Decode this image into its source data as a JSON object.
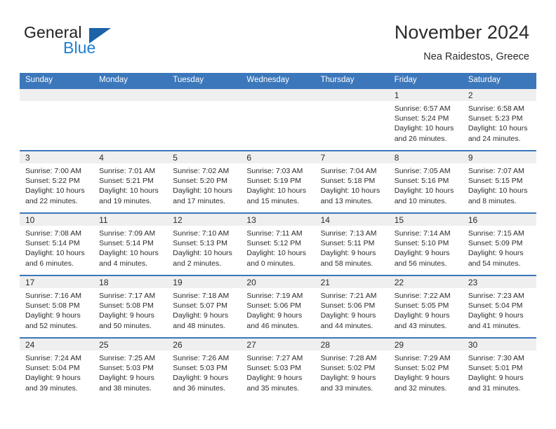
{
  "logo": {
    "text_primary": "General",
    "text_secondary": "Blue",
    "triangle_icon": "triangle-icon",
    "primary_color": "#231f20",
    "secondary_color": "#1e7fd4",
    "triangle_color": "#1b62a8"
  },
  "header": {
    "title": "November 2024",
    "subtitle": "Nea Raidestos, Greece"
  },
  "theme": {
    "header_bar_color": "#3b77ba",
    "day_band_color": "#efefef",
    "text_color": "#2b2b2b"
  },
  "weekdays": [
    "Sunday",
    "Monday",
    "Tuesday",
    "Wednesday",
    "Thursday",
    "Friday",
    "Saturday"
  ],
  "weeks": [
    [
      {
        "day": "",
        "sunrise": "",
        "sunset": "",
        "daylight_line1": "",
        "daylight_line2": ""
      },
      {
        "day": "",
        "sunrise": "",
        "sunset": "",
        "daylight_line1": "",
        "daylight_line2": ""
      },
      {
        "day": "",
        "sunrise": "",
        "sunset": "",
        "daylight_line1": "",
        "daylight_line2": ""
      },
      {
        "day": "",
        "sunrise": "",
        "sunset": "",
        "daylight_line1": "",
        "daylight_line2": ""
      },
      {
        "day": "",
        "sunrise": "",
        "sunset": "",
        "daylight_line1": "",
        "daylight_line2": ""
      },
      {
        "day": "1",
        "sunrise": "Sunrise: 6:57 AM",
        "sunset": "Sunset: 5:24 PM",
        "daylight_line1": "Daylight: 10 hours",
        "daylight_line2": "and 26 minutes."
      },
      {
        "day": "2",
        "sunrise": "Sunrise: 6:58 AM",
        "sunset": "Sunset: 5:23 PM",
        "daylight_line1": "Daylight: 10 hours",
        "daylight_line2": "and 24 minutes."
      }
    ],
    [
      {
        "day": "3",
        "sunrise": "Sunrise: 7:00 AM",
        "sunset": "Sunset: 5:22 PM",
        "daylight_line1": "Daylight: 10 hours",
        "daylight_line2": "and 22 minutes."
      },
      {
        "day": "4",
        "sunrise": "Sunrise: 7:01 AM",
        "sunset": "Sunset: 5:21 PM",
        "daylight_line1": "Daylight: 10 hours",
        "daylight_line2": "and 19 minutes."
      },
      {
        "day": "5",
        "sunrise": "Sunrise: 7:02 AM",
        "sunset": "Sunset: 5:20 PM",
        "daylight_line1": "Daylight: 10 hours",
        "daylight_line2": "and 17 minutes."
      },
      {
        "day": "6",
        "sunrise": "Sunrise: 7:03 AM",
        "sunset": "Sunset: 5:19 PM",
        "daylight_line1": "Daylight: 10 hours",
        "daylight_line2": "and 15 minutes."
      },
      {
        "day": "7",
        "sunrise": "Sunrise: 7:04 AM",
        "sunset": "Sunset: 5:18 PM",
        "daylight_line1": "Daylight: 10 hours",
        "daylight_line2": "and 13 minutes."
      },
      {
        "day": "8",
        "sunrise": "Sunrise: 7:05 AM",
        "sunset": "Sunset: 5:16 PM",
        "daylight_line1": "Daylight: 10 hours",
        "daylight_line2": "and 10 minutes."
      },
      {
        "day": "9",
        "sunrise": "Sunrise: 7:07 AM",
        "sunset": "Sunset: 5:15 PM",
        "daylight_line1": "Daylight: 10 hours",
        "daylight_line2": "and 8 minutes."
      }
    ],
    [
      {
        "day": "10",
        "sunrise": "Sunrise: 7:08 AM",
        "sunset": "Sunset: 5:14 PM",
        "daylight_line1": "Daylight: 10 hours",
        "daylight_line2": "and 6 minutes."
      },
      {
        "day": "11",
        "sunrise": "Sunrise: 7:09 AM",
        "sunset": "Sunset: 5:14 PM",
        "daylight_line1": "Daylight: 10 hours",
        "daylight_line2": "and 4 minutes."
      },
      {
        "day": "12",
        "sunrise": "Sunrise: 7:10 AM",
        "sunset": "Sunset: 5:13 PM",
        "daylight_line1": "Daylight: 10 hours",
        "daylight_line2": "and 2 minutes."
      },
      {
        "day": "13",
        "sunrise": "Sunrise: 7:11 AM",
        "sunset": "Sunset: 5:12 PM",
        "daylight_line1": "Daylight: 10 hours",
        "daylight_line2": "and 0 minutes."
      },
      {
        "day": "14",
        "sunrise": "Sunrise: 7:13 AM",
        "sunset": "Sunset: 5:11 PM",
        "daylight_line1": "Daylight: 9 hours",
        "daylight_line2": "and 58 minutes."
      },
      {
        "day": "15",
        "sunrise": "Sunrise: 7:14 AM",
        "sunset": "Sunset: 5:10 PM",
        "daylight_line1": "Daylight: 9 hours",
        "daylight_line2": "and 56 minutes."
      },
      {
        "day": "16",
        "sunrise": "Sunrise: 7:15 AM",
        "sunset": "Sunset: 5:09 PM",
        "daylight_line1": "Daylight: 9 hours",
        "daylight_line2": "and 54 minutes."
      }
    ],
    [
      {
        "day": "17",
        "sunrise": "Sunrise: 7:16 AM",
        "sunset": "Sunset: 5:08 PM",
        "daylight_line1": "Daylight: 9 hours",
        "daylight_line2": "and 52 minutes."
      },
      {
        "day": "18",
        "sunrise": "Sunrise: 7:17 AM",
        "sunset": "Sunset: 5:08 PM",
        "daylight_line1": "Daylight: 9 hours",
        "daylight_line2": "and 50 minutes."
      },
      {
        "day": "19",
        "sunrise": "Sunrise: 7:18 AM",
        "sunset": "Sunset: 5:07 PM",
        "daylight_line1": "Daylight: 9 hours",
        "daylight_line2": "and 48 minutes."
      },
      {
        "day": "20",
        "sunrise": "Sunrise: 7:19 AM",
        "sunset": "Sunset: 5:06 PM",
        "daylight_line1": "Daylight: 9 hours",
        "daylight_line2": "and 46 minutes."
      },
      {
        "day": "21",
        "sunrise": "Sunrise: 7:21 AM",
        "sunset": "Sunset: 5:06 PM",
        "daylight_line1": "Daylight: 9 hours",
        "daylight_line2": "and 44 minutes."
      },
      {
        "day": "22",
        "sunrise": "Sunrise: 7:22 AM",
        "sunset": "Sunset: 5:05 PM",
        "daylight_line1": "Daylight: 9 hours",
        "daylight_line2": "and 43 minutes."
      },
      {
        "day": "23",
        "sunrise": "Sunrise: 7:23 AM",
        "sunset": "Sunset: 5:04 PM",
        "daylight_line1": "Daylight: 9 hours",
        "daylight_line2": "and 41 minutes."
      }
    ],
    [
      {
        "day": "24",
        "sunrise": "Sunrise: 7:24 AM",
        "sunset": "Sunset: 5:04 PM",
        "daylight_line1": "Daylight: 9 hours",
        "daylight_line2": "and 39 minutes."
      },
      {
        "day": "25",
        "sunrise": "Sunrise: 7:25 AM",
        "sunset": "Sunset: 5:03 PM",
        "daylight_line1": "Daylight: 9 hours",
        "daylight_line2": "and 38 minutes."
      },
      {
        "day": "26",
        "sunrise": "Sunrise: 7:26 AM",
        "sunset": "Sunset: 5:03 PM",
        "daylight_line1": "Daylight: 9 hours",
        "daylight_line2": "and 36 minutes."
      },
      {
        "day": "27",
        "sunrise": "Sunrise: 7:27 AM",
        "sunset": "Sunset: 5:03 PM",
        "daylight_line1": "Daylight: 9 hours",
        "daylight_line2": "and 35 minutes."
      },
      {
        "day": "28",
        "sunrise": "Sunrise: 7:28 AM",
        "sunset": "Sunset: 5:02 PM",
        "daylight_line1": "Daylight: 9 hours",
        "daylight_line2": "and 33 minutes."
      },
      {
        "day": "29",
        "sunrise": "Sunrise: 7:29 AM",
        "sunset": "Sunset: 5:02 PM",
        "daylight_line1": "Daylight: 9 hours",
        "daylight_line2": "and 32 minutes."
      },
      {
        "day": "30",
        "sunrise": "Sunrise: 7:30 AM",
        "sunset": "Sunset: 5:01 PM",
        "daylight_line1": "Daylight: 9 hours",
        "daylight_line2": "and 31 minutes."
      }
    ]
  ]
}
